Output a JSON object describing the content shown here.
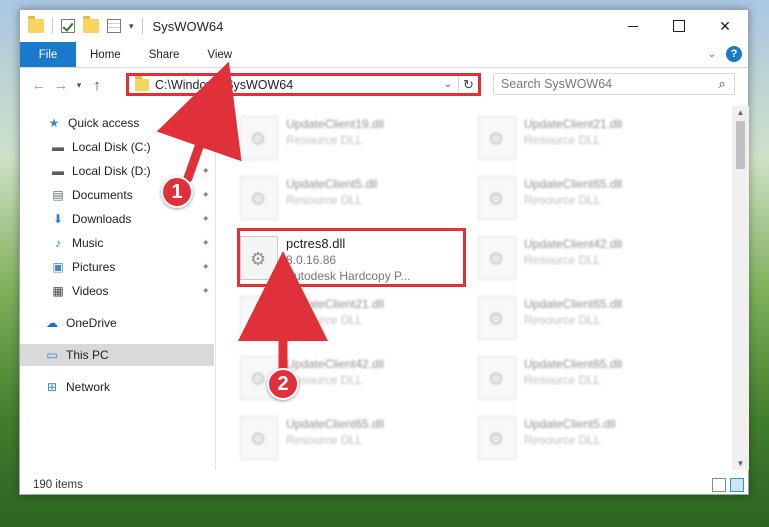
{
  "window": {
    "title": "SysWOW64",
    "controls": {
      "minimize": "",
      "maximize": "",
      "close": "✕"
    }
  },
  "ribbon": {
    "tabs": [
      "File",
      "Home",
      "Share",
      "View"
    ],
    "help": "?"
  },
  "nav": {
    "back": "←",
    "forward": "→",
    "recent": "▾",
    "up": "↑",
    "address": "C:\\Windows\\SysWOW64",
    "address_dropdown": "⌄",
    "refresh": "↻",
    "search_placeholder": "Search SysWOW64",
    "search_icon": "⌕"
  },
  "sidebar": {
    "items": [
      {
        "label": "Quick access",
        "icon": "star-icon",
        "glyph": "★",
        "color": "#3a86d6",
        "pinned": false
      },
      {
        "label": "Local Disk (C:)",
        "icon": "drive-icon",
        "glyph": "▬",
        "color": "#5a5a5a",
        "pinned": true
      },
      {
        "label": "Local Disk (D:)",
        "icon": "drive-icon",
        "glyph": "▬",
        "color": "#5a5a5a",
        "pinned": true
      },
      {
        "label": "Documents",
        "icon": "documents-icon",
        "glyph": "▤",
        "color": "#5a6b7d",
        "pinned": true
      },
      {
        "label": "Downloads",
        "icon": "download-icon",
        "glyph": "⬇",
        "color": "#2d7fd1",
        "pinned": true
      },
      {
        "label": "Music",
        "icon": "music-icon",
        "glyph": "♪",
        "color": "#2d7fd1",
        "pinned": true
      },
      {
        "label": "Pictures",
        "icon": "pictures-icon",
        "glyph": "▣",
        "color": "#3f86c8",
        "pinned": true
      },
      {
        "label": "Videos",
        "icon": "videos-icon",
        "glyph": "▦",
        "color": "#444",
        "pinned": true
      },
      {
        "label": "OneDrive",
        "icon": "cloud-icon",
        "glyph": "☁",
        "color": "#1f6ec7",
        "pinned": false
      },
      {
        "label": "This PC",
        "icon": "computer-icon",
        "glyph": "▭",
        "color": "#2f7fd1",
        "pinned": false
      },
      {
        "label": "Network",
        "icon": "network-icon",
        "glyph": "⊞",
        "color": "#2f7fd1",
        "pinned": false
      }
    ],
    "pin_glyph": "📌"
  },
  "files": {
    "left": [
      {
        "name": "UpdateClient19.dll",
        "sub": "Resource DLL"
      },
      {
        "name": "UpdateClient5.dll",
        "sub": "Resource DLL"
      },
      {
        "name": "UpdateClient21.dll",
        "sub": "Resource DLL"
      },
      {
        "name": "UpdateClient42.dll",
        "sub": "Resource DLL"
      },
      {
        "name": "UpdateClient65.dll",
        "sub": "Resource DLL"
      }
    ],
    "right": [
      {
        "name": "UpdateClient21.dll",
        "sub": "Resource DLL"
      },
      {
        "name": "UpdateClient65.dll",
        "sub": "Resource DLL"
      },
      {
        "name": "UpdateClient42.dll",
        "sub": "Resource DLL"
      },
      {
        "name": "UpdateClient65.dll",
        "sub": "Resource DLL"
      },
      {
        "name": "UpdateClient65.dll",
        "sub": "Resource DLL"
      },
      {
        "name": "UpdateClient5.dll",
        "sub": "Resource DLL"
      }
    ],
    "highlighted": {
      "name": "pctres8.dll",
      "version": "8.0.16.86",
      "description": "Autodesk Hardcopy P..."
    }
  },
  "status": {
    "items": "190 items"
  },
  "annotations": {
    "step1": "1",
    "step2": "2",
    "color": "#e0313a"
  }
}
